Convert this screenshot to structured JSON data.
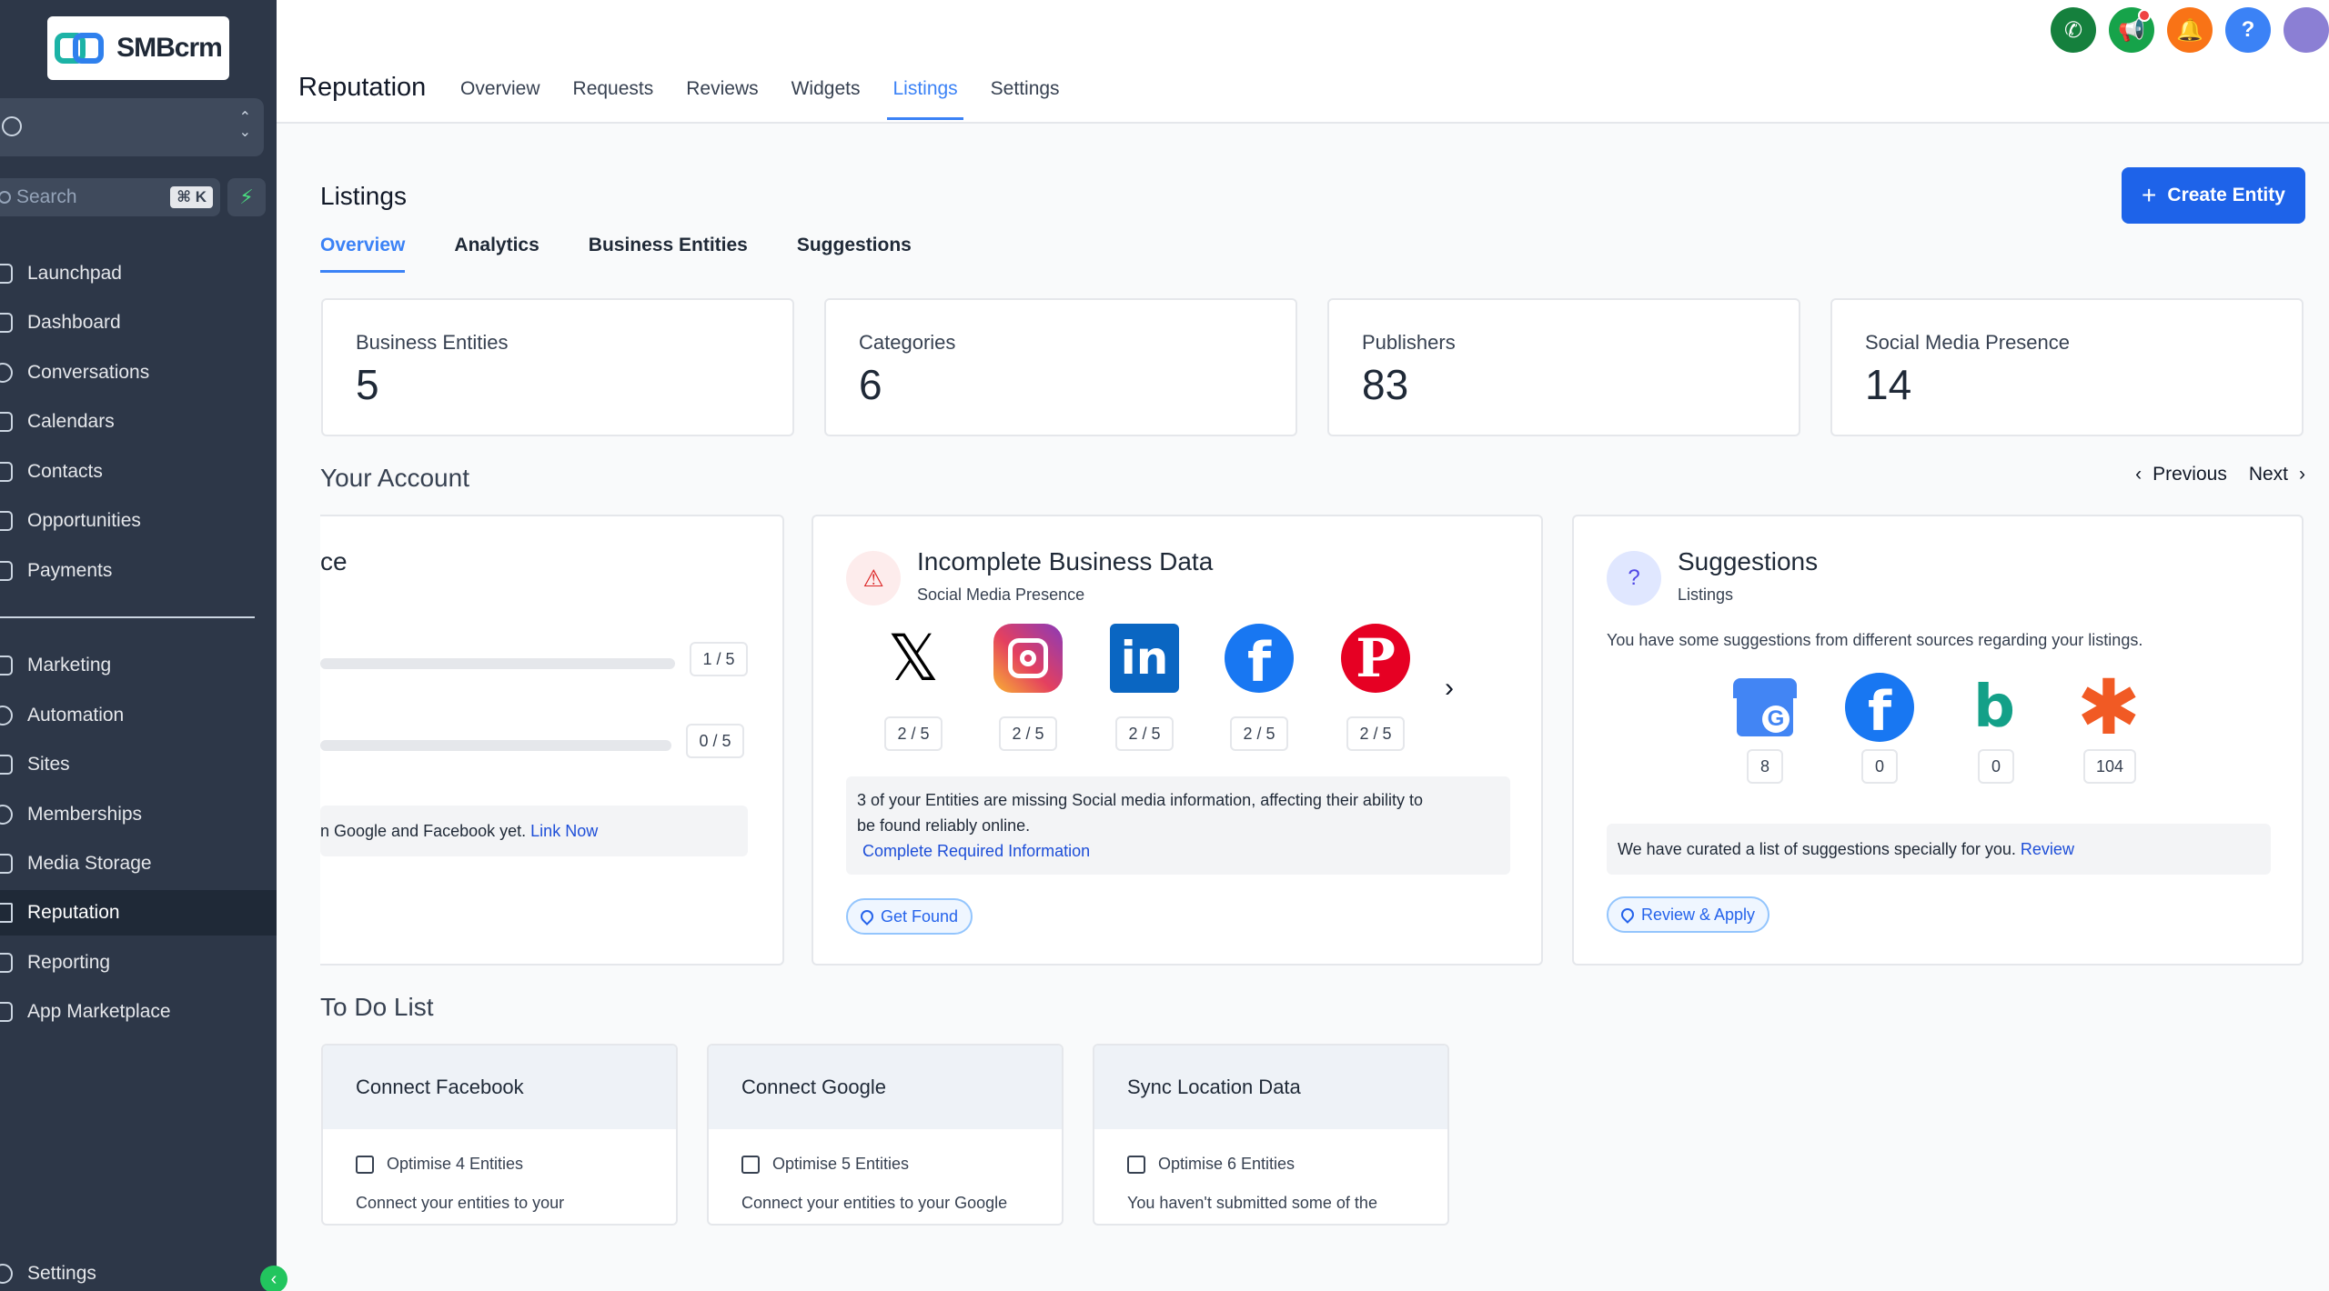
{
  "brand": {
    "name": "SMBcrm"
  },
  "sidebar": {
    "search_placeholder": "Search",
    "search_shortcut": "⌘ K",
    "items": [
      {
        "label": "Launchpad",
        "icon": "rocket-icon"
      },
      {
        "label": "Dashboard",
        "icon": "grid-icon"
      },
      {
        "label": "Conversations",
        "icon": "chat-icon"
      },
      {
        "label": "Calendars",
        "icon": "calendar-icon"
      },
      {
        "label": "Contacts",
        "icon": "contacts-icon"
      },
      {
        "label": "Opportunities",
        "icon": "opportunities-icon"
      },
      {
        "label": "Payments",
        "icon": "payments-icon"
      },
      {
        "label": "Marketing",
        "icon": "send-icon"
      },
      {
        "label": "Automation",
        "icon": "automation-icon"
      },
      {
        "label": "Sites",
        "icon": "sites-icon"
      },
      {
        "label": "Memberships",
        "icon": "memberships-icon"
      },
      {
        "label": "Media Storage",
        "icon": "image-icon"
      },
      {
        "label": "Reputation",
        "icon": "star-icon"
      },
      {
        "label": "Reporting",
        "icon": "chart-icon"
      },
      {
        "label": "App Marketplace",
        "icon": "apps-icon"
      }
    ],
    "settings_label": "Settings"
  },
  "topbar": {
    "title": "Reputation",
    "tabs": [
      "Overview",
      "Requests",
      "Reviews",
      "Widgets",
      "Listings",
      "Settings"
    ],
    "active_tab": "Listings",
    "icon_colors": {
      "phone": "#15803d",
      "megaphone": "#16a34a",
      "bell": "#f97316",
      "help": "#3b82f6",
      "avatar": "#8b7fd4"
    }
  },
  "main": {
    "title": "Listings",
    "create_button": "Create Entity",
    "sub_tabs": [
      "Overview",
      "Analytics",
      "Business Entities",
      "Suggestions"
    ],
    "active_sub_tab": "Overview",
    "stats": [
      {
        "label": "Business Entities",
        "value": "5"
      },
      {
        "label": "Categories",
        "value": "6"
      },
      {
        "label": "Publishers",
        "value": "83"
      },
      {
        "label": "Social Media Presence",
        "value": "14"
      }
    ],
    "your_account_title": "Your Account",
    "pager": {
      "previous": "Previous",
      "next": "Next"
    },
    "partial_card": {
      "title_fragment": "ce",
      "rows": [
        {
          "ratio": "1 / 5"
        },
        {
          "ratio": "0 / 5"
        }
      ],
      "note_text": "n Google and Facebook yet.",
      "note_link": "Link Now"
    },
    "incomplete_card": {
      "title": "Incomplete Business Data",
      "subtitle": "Social Media Presence",
      "networks": [
        {
          "name": "x-icon",
          "ratio": "2 / 5"
        },
        {
          "name": "instagram-icon",
          "ratio": "2 / 5"
        },
        {
          "name": "linkedin-icon",
          "ratio": "2 / 5"
        },
        {
          "name": "facebook-icon",
          "ratio": "2 / 5"
        },
        {
          "name": "pinterest-icon",
          "ratio": "2 / 5"
        }
      ],
      "note_line1": "3 of your Entities are missing Social media information, affecting their ability to",
      "note_line2": "be found reliably online.",
      "note_link": "Complete Required Information",
      "action": "Get Found"
    },
    "suggestions_card": {
      "title": "Suggestions",
      "subtitle": "Listings",
      "description": "You have some suggestions from different sources regarding your listings.",
      "sources": [
        {
          "name": "google-business-icon",
          "count": "8"
        },
        {
          "name": "facebook-icon",
          "count": "0"
        },
        {
          "name": "bing-icon",
          "count": "0"
        },
        {
          "name": "yelp-burst-icon",
          "count": "104"
        }
      ],
      "note_text": "We have curated a list of suggestions specially for you.",
      "note_link": "Review",
      "action": "Review & Apply"
    },
    "todo_title": "To Do List",
    "todos": [
      {
        "title": "Connect Facebook",
        "meta": "Optimise 4 Entities",
        "desc": "Connect your entities to your"
      },
      {
        "title": "Connect Google",
        "meta": "Optimise 5 Entities",
        "desc": "Connect your entities to your Google"
      },
      {
        "title": "Sync Location Data",
        "meta": "Optimise 6 Entities",
        "desc": "You haven't submitted some of the"
      }
    ]
  }
}
